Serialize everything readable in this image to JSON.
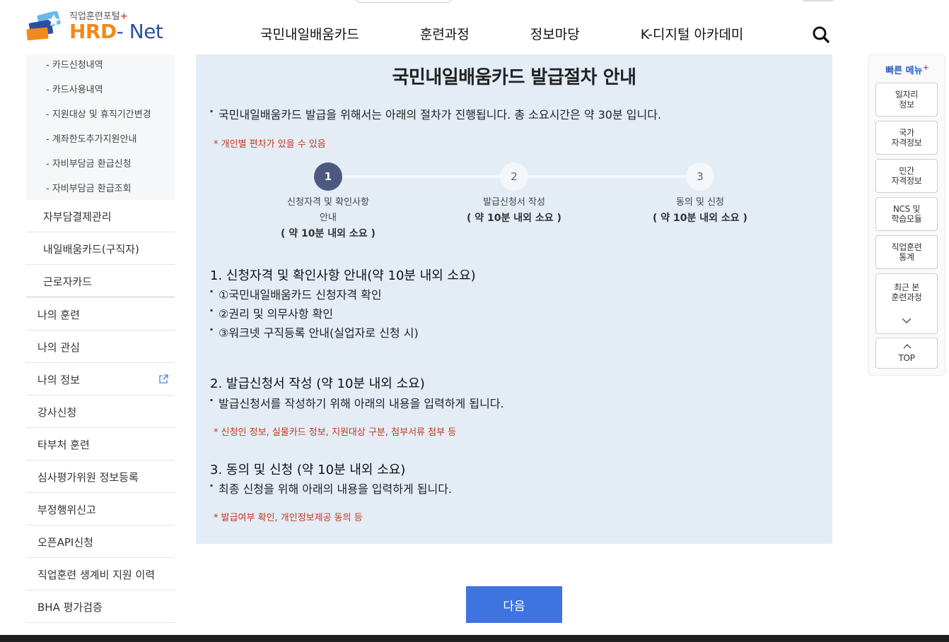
{
  "logo": {
    "sub": "직업훈련포털",
    "plus": "+",
    "main_a": "HRD",
    "main_b": "- Net"
  },
  "gnb": [
    "국민내일배움카드",
    "훈련과정",
    "정보마당",
    "K-디지털 아카데미"
  ],
  "sidebar": {
    "sub_items": [
      "- 카드신청내역",
      "- 카드사용내역",
      "- 지원대상 및 휴직기간변경",
      "- 계좌한도추가지원안내",
      "- 자비부담금 환급신청",
      "- 자비부담금 환급조회"
    ],
    "lv2_items": [
      "자부담결제관리",
      "내일배움카드(구직자)",
      "근로자카드"
    ],
    "lv1_items": [
      "나의 훈련",
      "나의 관심",
      "나의 정보",
      "강사신청",
      "타부처 훈련",
      "심사평가위원 정보등록",
      "부정행위신고",
      "오픈API신청",
      "직업훈련 생계비 지원 이력",
      "BHA 평가검증"
    ]
  },
  "content": {
    "title": "국민내일배움카드 발급절차 안내",
    "intro": "국민내일배움카드 발급을 위해서는 아래의 절차가 진행됩니다. 총 소요시간은 약 30분 입니다.",
    "intro_note": "* 개인별 편차가 있을 수 있음",
    "steps": [
      {
        "num": "1",
        "label_a": "신청자격 및 확인사항",
        "label_b": "안내",
        "dur": "( 약 10분 내외 소요 )"
      },
      {
        "num": "2",
        "label_a": "발급신청서 작성",
        "label_b": "",
        "dur": "( 약 10분 내외 소요 )"
      },
      {
        "num": "3",
        "label_a": "동의 및 신청",
        "label_b": "",
        "dur": "( 약 10분 내외 소요 )"
      }
    ],
    "sec1": {
      "title": "1. 신청자격 및 확인사항 안내(약 10분 내외 소요)",
      "items": [
        "①국민내일배움카드 신청자격 확인",
        "②권리 및 의무사항 확인",
        "③워크넷 구직등록 안내(실업자로 신청 시)"
      ]
    },
    "sec2": {
      "title": "2. 발급신청서 작성 (약 10분 내외 소요)",
      "desc": "발급신청서를 작성하기 위해 아래의 내용을 입력하게 됩니다.",
      "note": "* 신청인 정보, 실물카드 정보, 지원대상 구분, 첨부서류 첨부 등"
    },
    "sec3": {
      "title": "3. 동의 및 신청 (약 10분 내외 소요)",
      "desc": "최종 신청을 위해 아래의 내용을 입력하게 됩니다.",
      "note": "* 발급여부 확인, 개인정보제공 동의 등"
    }
  },
  "quick": {
    "title": "빠른 메뉴",
    "plus": "+",
    "buttons": [
      {
        "l1": "일자리",
        "l2": "정보"
      },
      {
        "l1": "국가",
        "l2": "자격정보"
      },
      {
        "l1": "민간",
        "l2": "자격정보"
      },
      {
        "l1": "NCS 및",
        "l2": "학습모듈"
      },
      {
        "l1": "직업훈련",
        "l2": "통계"
      },
      {
        "l1": "최근 본",
        "l2": "훈련과정"
      }
    ],
    "top": "TOP"
  },
  "next_label": "다음",
  "colors": {
    "accent": "#3e73e0",
    "content_bg": "#e4ecf6",
    "note": "#c5381b",
    "step_active": "#4d5a80"
  }
}
